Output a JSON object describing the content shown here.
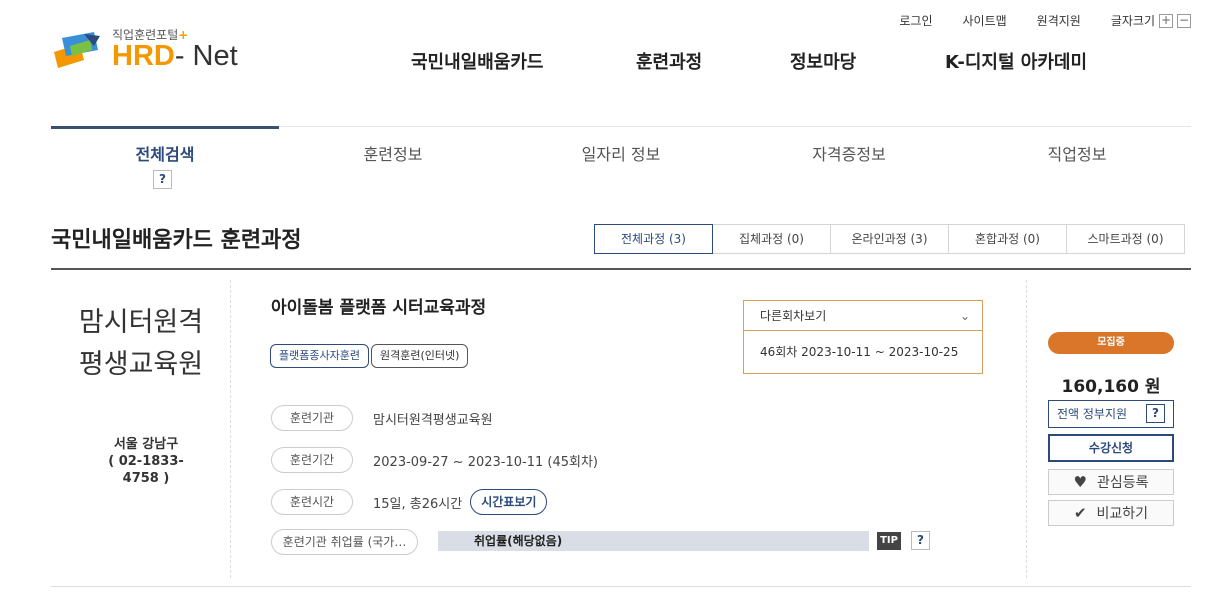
{
  "header": {
    "logo_sub": "직업훈련포털",
    "logo_plus": "+",
    "logo_hrd": "HRD",
    "logo_net": "- Net",
    "util": {
      "login": "로그인",
      "sitemap": "사이트맵",
      "remote": "원격지원",
      "font_size": "글자크기",
      "font_plus": "+",
      "font_minus": "−"
    },
    "gnb": [
      "국민내일배움카드",
      "훈련과정",
      "정보마당",
      "K-디지털 아카데미"
    ]
  },
  "tabs": [
    "전체검색",
    "훈련정보",
    "일자리 정보",
    "자격증정보",
    "직업정보"
  ],
  "page": {
    "title": "국민내일배움카드 훈련과정",
    "filters": [
      "전체과정 (3)",
      "집체과정 (0)",
      "온라인과정 (3)",
      "혼합과정 (0)",
      "스마트과정 (0)"
    ]
  },
  "card": {
    "org_line1": "맘시터원격",
    "org_line2": "평생교육원",
    "location": "서울 강남구",
    "phone": "( 02-1833-4758 )",
    "help": "?",
    "course_title": "아이돌봄 플랫폼 시터교육과정",
    "tags": [
      "플랫폼종사자훈련",
      "원격훈련(인터넷)"
    ],
    "rows": {
      "org_label": "훈련기관",
      "org_value": "맘시터원격평생교육원",
      "period_label": "훈련기간",
      "period_value": "2023-09-27 ~ 2023-10-11 (45회차)",
      "time_label": "훈련시간",
      "time_value": "15일, 총26시간",
      "timetable_btn": "시간표보기",
      "emp_label": "훈련기관 취업률 (국가…",
      "emp_value": "취업률(해당없음)",
      "tip": "TIP"
    },
    "round": {
      "select_label": "다른회차보기",
      "option": "46회차 2023-10-11 ~ 2023-10-25"
    },
    "side": {
      "badge": "모집중",
      "price": "160,160 원",
      "grant": "전액 정부지원",
      "apply": "수강신청",
      "wish": "관심등록",
      "compare": "비교하기"
    }
  },
  "colors": {
    "accent": "#2c4a7c",
    "badge": "#d9762a",
    "logo_orange": "#f39800"
  }
}
